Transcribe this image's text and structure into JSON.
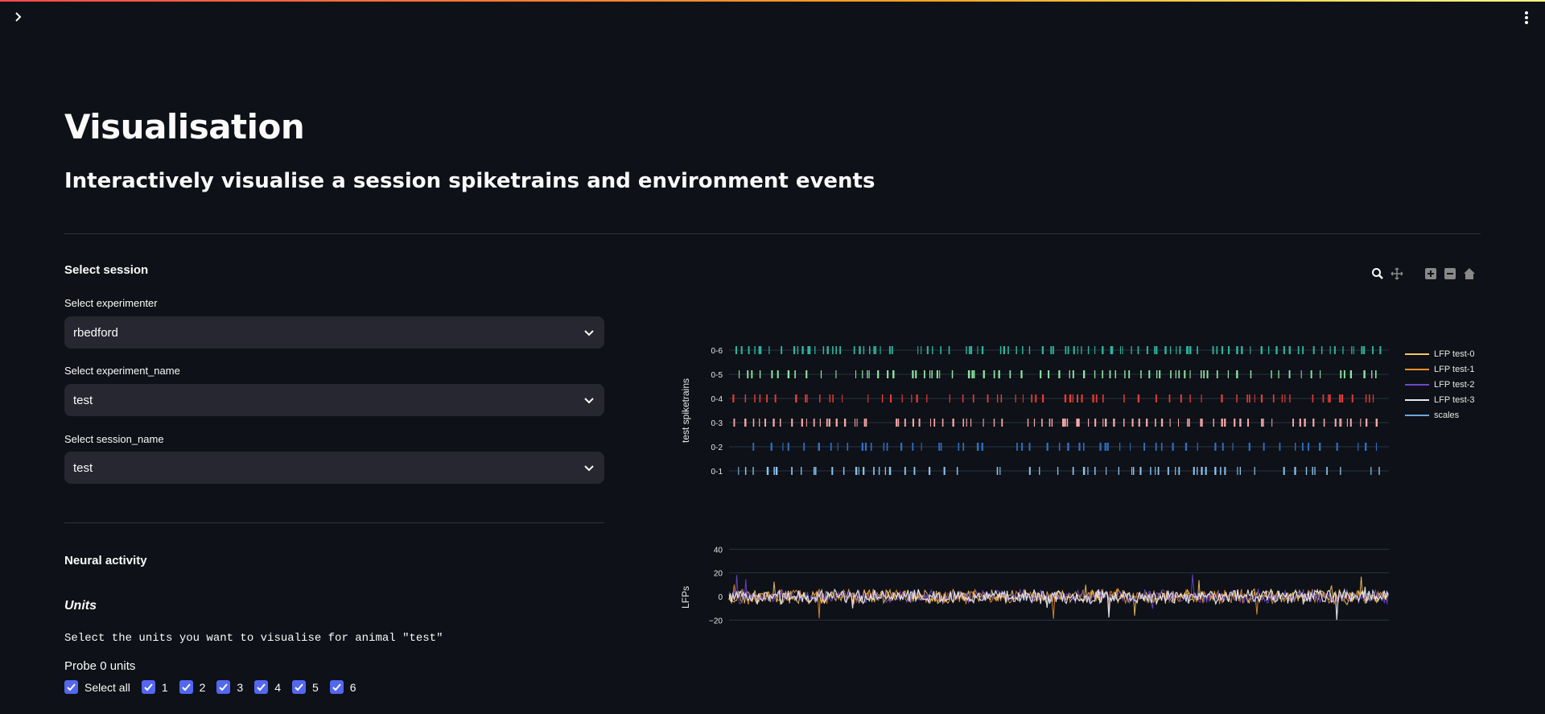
{
  "header": {
    "sidebar_toggle_icon": "chevron-right-icon",
    "menu_icon": "kebab-menu-icon"
  },
  "page": {
    "title": "Visualisation",
    "subtitle": "Interactively visualise a session spiketrains and environment events"
  },
  "session": {
    "heading": "Select session",
    "experimenter": {
      "label": "Select experimenter",
      "value": "rbedford"
    },
    "experiment_name": {
      "label": "Select experiment_name",
      "value": "test"
    },
    "session_name": {
      "label": "Select session_name",
      "value": "test"
    }
  },
  "neural": {
    "heading": "Neural activity",
    "units_heading": "Units",
    "instruction": "Select the units you want to visualise for animal \"test\"",
    "probe_label": "Probe 0 units",
    "checkboxes": [
      {
        "label": "Select all",
        "checked": true
      },
      {
        "label": "1",
        "checked": true
      },
      {
        "label": "2",
        "checked": true
      },
      {
        "label": "3",
        "checked": true
      },
      {
        "label": "4",
        "checked": true
      },
      {
        "label": "5",
        "checked": true
      },
      {
        "label": "6",
        "checked": true
      }
    ]
  },
  "modebar": [
    "zoom-icon",
    "pan-icon",
    "zoom-in-icon",
    "zoom-out-icon",
    "home-icon"
  ],
  "chart_data": {
    "type": "line",
    "spiketrains": {
      "ylabel": "test spiketrains",
      "units": [
        {
          "label": "0-6",
          "color": "#2bb5a0",
          "density": 0.55
        },
        {
          "label": "0-5",
          "color": "#8fe5a0",
          "density": 0.35
        },
        {
          "label": "0-4",
          "color": "#e83b36",
          "density": 0.25
        },
        {
          "label": "0-3",
          "color": "#f7a8a8",
          "density": 0.4
        },
        {
          "label": "0-2",
          "color": "#2f6fc4",
          "density": 0.05
        },
        {
          "label": "0-1",
          "color": "#8cc4ef",
          "density": 0.18
        }
      ]
    },
    "lfp": {
      "ylabel": "LFPs",
      "yticks": [
        40,
        20,
        0,
        -20
      ],
      "ylim": [
        -30,
        45
      ]
    },
    "legend": [
      {
        "name": "LFP test-0",
        "color": "#f6c85f"
      },
      {
        "name": "LFP test-1",
        "color": "#f28e2b"
      },
      {
        "name": "LFP test-2",
        "color": "#6a4ac9"
      },
      {
        "name": "LFP test-3",
        "color": "#e8e8f0"
      },
      {
        "name": "scales",
        "color": "#6fa8dc"
      }
    ]
  }
}
